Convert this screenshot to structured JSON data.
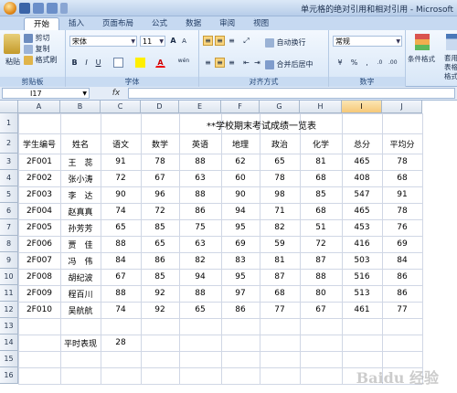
{
  "window": {
    "title": "单元格的绝对引用和相对引用 - Microsoft"
  },
  "ribbon_tabs": [
    "开始",
    "插入",
    "页面布局",
    "公式",
    "数据",
    "审阅",
    "视图"
  ],
  "clipboard": {
    "paste": "粘贴",
    "cut": "剪切",
    "copy": "复制",
    "format_painter": "格式刷",
    "label": "剪贴板"
  },
  "font": {
    "name": "宋体",
    "size": "11",
    "label": "字体",
    "bold": "B",
    "italic": "I",
    "underline": "U",
    "wen": "wén"
  },
  "alignment": {
    "wrap": "自动换行",
    "merge": "合并后居中",
    "label": "对齐方式"
  },
  "number": {
    "format": "常规",
    "label": "数字",
    "percent": "%",
    "comma": ","
  },
  "styles": {
    "cond_format": "条件格式",
    "table_format": "套用表格格式"
  },
  "formula_bar": {
    "cell_ref": "I17",
    "fx": "fx",
    "value": ""
  },
  "columns": [
    "A",
    "B",
    "C",
    "D",
    "E",
    "F",
    "G",
    "H",
    "I",
    "J"
  ],
  "selected_column": "I",
  "rows": [
    "1",
    "2",
    "3",
    "4",
    "5",
    "6",
    "7",
    "8",
    "9",
    "10",
    "11",
    "12",
    "13",
    "14",
    "15",
    "16"
  ],
  "sheet": {
    "title": "**学校期末考试成绩一览表",
    "headers": [
      "学生编号",
      "姓名",
      "语文",
      "数学",
      "英语",
      "地理",
      "政治",
      "化学",
      "总分",
      "平均分"
    ],
    "data": [
      [
        "2F001",
        "王　蕊",
        "91",
        "78",
        "88",
        "62",
        "65",
        "81",
        "465",
        "78"
      ],
      [
        "2F002",
        "张小涛",
        "72",
        "67",
        "63",
        "60",
        "78",
        "68",
        "408",
        "68"
      ],
      [
        "2F003",
        "李　达",
        "90",
        "96",
        "88",
        "90",
        "98",
        "85",
        "547",
        "91"
      ],
      [
        "2F004",
        "赵真真",
        "74",
        "72",
        "86",
        "94",
        "71",
        "68",
        "465",
        "78"
      ],
      [
        "2F005",
        "孙芳芳",
        "65",
        "85",
        "75",
        "95",
        "82",
        "51",
        "453",
        "76"
      ],
      [
        "2F006",
        "贾　佳",
        "88",
        "65",
        "63",
        "69",
        "59",
        "72",
        "416",
        "69"
      ],
      [
        "2F007",
        "冯　伟",
        "84",
        "86",
        "82",
        "83",
        "81",
        "87",
        "503",
        "84"
      ],
      [
        "2F008",
        "胡纪波",
        "67",
        "85",
        "94",
        "95",
        "87",
        "88",
        "516",
        "86"
      ],
      [
        "2F009",
        "程百川",
        "88",
        "92",
        "88",
        "97",
        "68",
        "80",
        "513",
        "86"
      ],
      [
        "2F010",
        "吴航航",
        "74",
        "92",
        "65",
        "86",
        "77",
        "67",
        "461",
        "77"
      ]
    ],
    "ordinary_label": "平时表现",
    "ordinary_value": "28"
  },
  "watermark": "Baidu 经验"
}
